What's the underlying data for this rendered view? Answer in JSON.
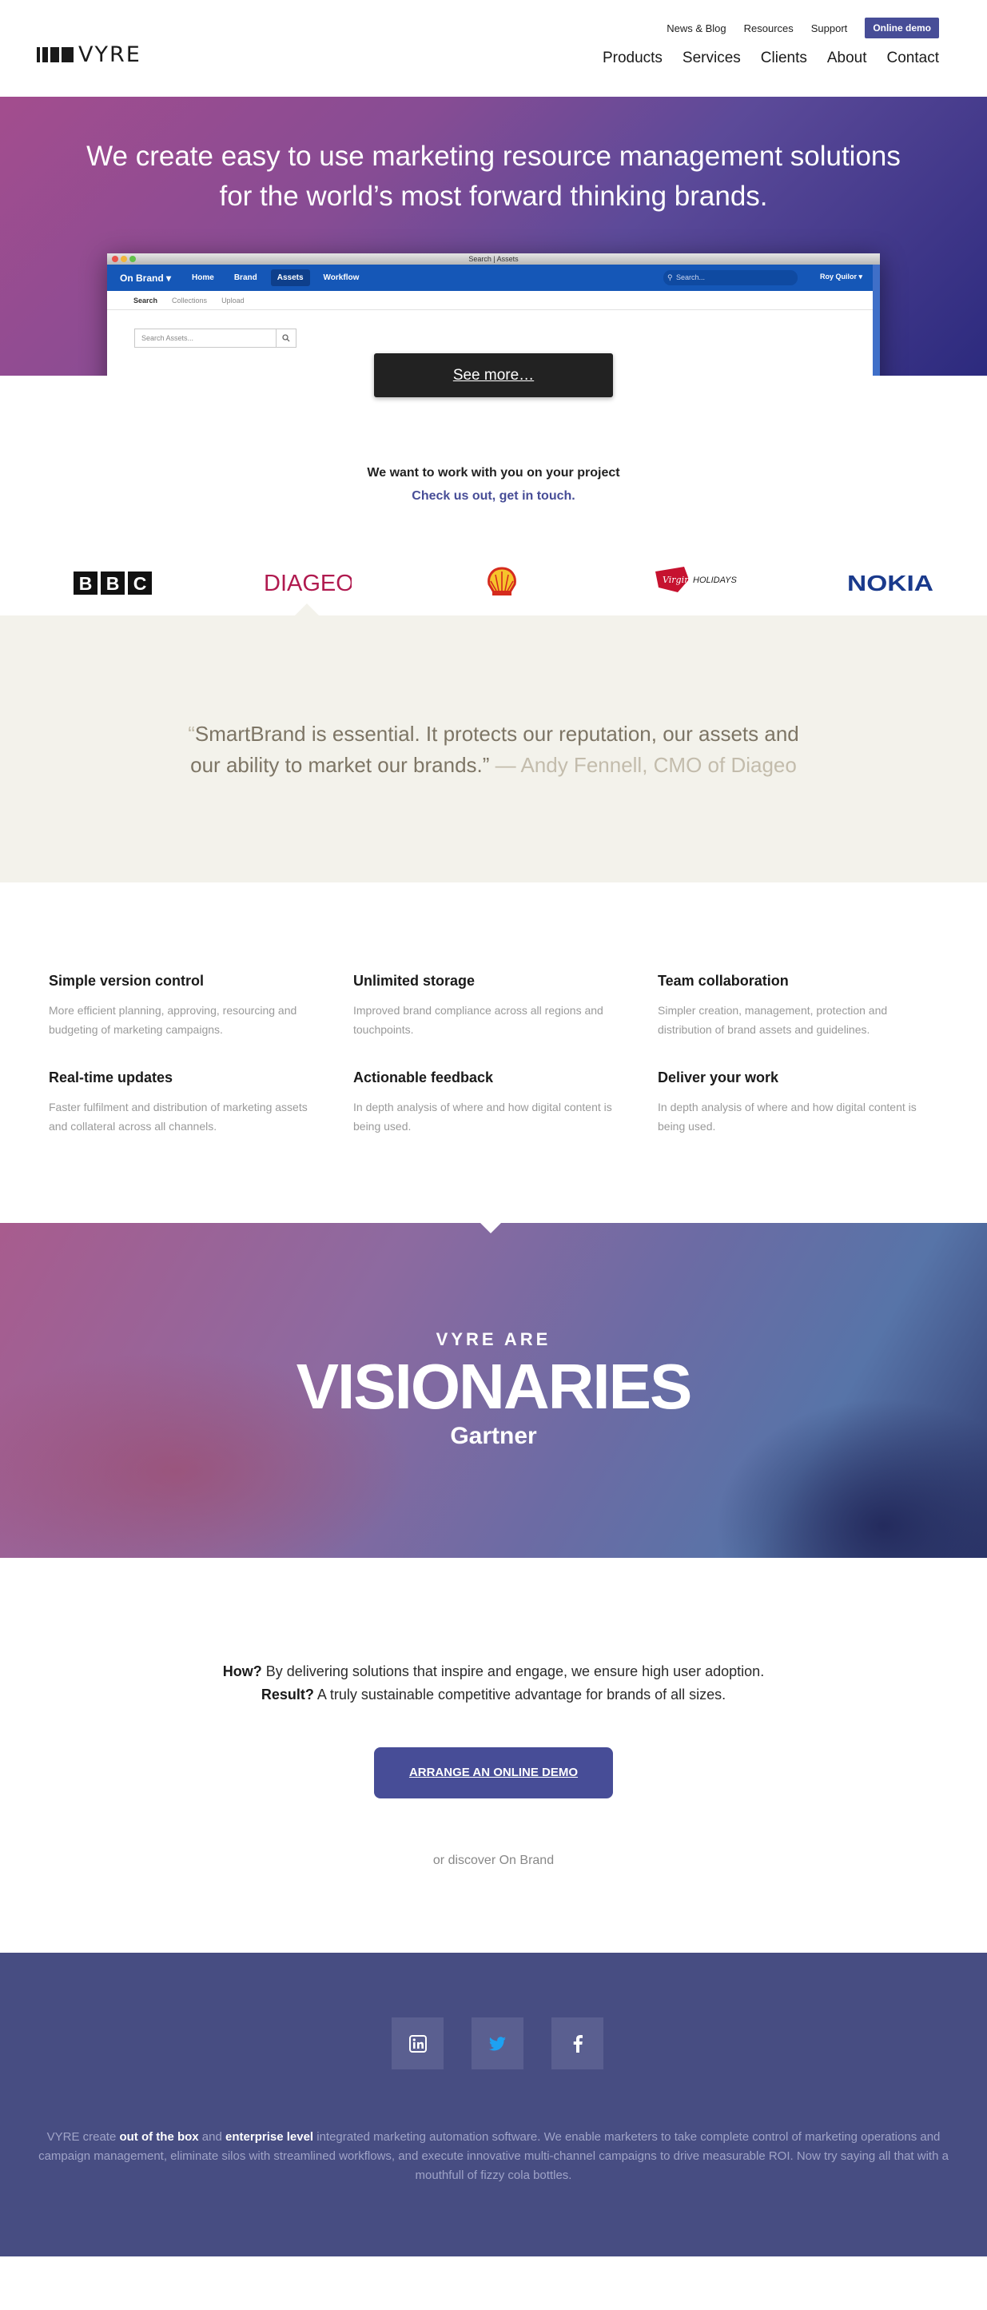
{
  "header": {
    "logo_text": "VYRE",
    "top_links": [
      "News & Blog",
      "Resources",
      "Support"
    ],
    "online_demo": "Online demo",
    "main_nav": [
      "Products",
      "Services",
      "Clients",
      "About",
      "Contact"
    ]
  },
  "hero": {
    "title_line1": "We create easy to use marketing resource management solutions",
    "title_line2": "for the world’s most forward thinking brands.",
    "browser_title": "Search | Assets",
    "app": {
      "brand": "On Brand",
      "nav": [
        "Home",
        "Brand",
        "Assets",
        "Workflow"
      ],
      "search_placeholder": "Search...",
      "user": "Roy Quilor",
      "subnav": [
        "Search",
        "Collections",
        "Upload"
      ],
      "asset_search_placeholder": "Search Assets..."
    },
    "see_more": "See more…"
  },
  "work_with": {
    "line1": "We want to work with you on your project",
    "line2": "Check us out, get in touch."
  },
  "client_logos": [
    {
      "name": "BBC"
    },
    {
      "name": "DIAGEO"
    },
    {
      "name": "Shell"
    },
    {
      "name": "Virgin Holidays",
      "text": "HOLIDAYS"
    },
    {
      "name": "NOKIA"
    }
  ],
  "testimonial": {
    "open_mark": "“",
    "quote_line1": "SmartBrand is essential. It protects our reputation, our assets and",
    "quote_line2": "our ability to market our brands.”",
    "attribution": "— Andy Fennell, CMO of Diageo"
  },
  "features": [
    {
      "title": "Simple version control",
      "text": "More efficient planning, approving, resourcing and budgeting of marketing campaigns."
    },
    {
      "title": "Unlimited storage",
      "text": "Improved brand compliance across all regions and touchpoints."
    },
    {
      "title": "Team collaboration",
      "text": "Simpler creation, management, protection and distribution of brand assets and guidelines."
    },
    {
      "title": "Real-time updates",
      "text": "Faster fulfilment and distribution of marketing assets and collateral across all channels."
    },
    {
      "title": "Actionable feedback",
      "text": "In depth analysis of where and how digital content is being used."
    },
    {
      "title": "Deliver your work",
      "text": "In depth analysis of where and how digital content is being used."
    }
  ],
  "vision": {
    "small": "VYRE ARE",
    "big": "VISIONARIES",
    "source": "Gartner"
  },
  "how": {
    "how_label": "How?",
    "how_text": " By delivering solutions that inspire and engage, we ensure high user adoption.",
    "result_label": "Result?",
    "result_text": " A truly sustainable competitive advantage for brands of all sizes.",
    "cta": "ARRANGE AN ONLINE DEMO",
    "discover": "or discover On Brand"
  },
  "footer": {
    "social": [
      "linkedin-icon",
      "twitter-icon",
      "facebook-icon"
    ],
    "blurb_1": "VYRE create ",
    "blurb_b1": "out of the box",
    "blurb_2": " and ",
    "blurb_b2": "enterprise level",
    "blurb_3": " integrated marketing automation software. We enable marketers to take complete control of marketing operations and campaign management, eliminate silos with streamlined workflows, and execute innovative multi-channel campaigns to drive measurable ROI. Now try saying all that with a mouthfull of fizzy cola bottles."
  },
  "colors": {
    "accent": "#474d97",
    "footer_bg": "#474d82",
    "testimonial_bg": "#f3f2eb",
    "app_bar": "#1557b7"
  }
}
